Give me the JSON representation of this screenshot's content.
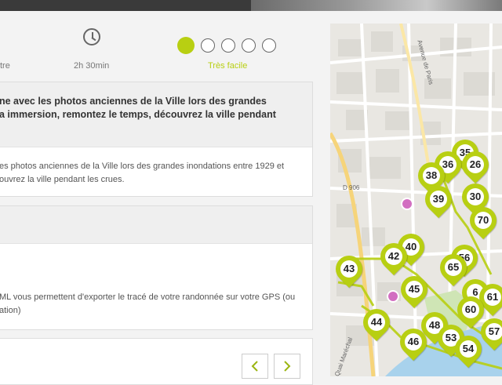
{
  "info": {
    "difficulty_partial": "tre",
    "duration": "2h 30min",
    "level": "Très facile"
  },
  "difficulty_dots": [
    true,
    false,
    false,
    false,
    false
  ],
  "level_color": "#b8cf12",
  "card1": {
    "head_line1": "ne avec les photos anciennes de la Ville lors des grandes",
    "head_line2": "a immersion, remontez le temps, découvrez la ville pendant",
    "body_line1": "es photos anciennes de la Ville lors des grandes inondations entre 1929 et",
    "body_line2": "ouvrez la ville pendant les crues."
  },
  "card2": {
    "body_line1": "ML vous permettent d'exporter le tracé de votre randonnée sur votre GPS (ou",
    "body_line2": "ation)"
  },
  "nav": {
    "prev": "‹",
    "next": "›"
  },
  "map": {
    "street_labels": [
      "Avenue de Paris",
      "D 906",
      "Quai Maréchal"
    ],
    "markers": [
      {
        "num": "35"
      },
      {
        "num": "36"
      },
      {
        "num": "26"
      },
      {
        "num": "38"
      },
      {
        "num": "39"
      },
      {
        "num": "30"
      },
      {
        "num": "70"
      },
      {
        "num": "40"
      },
      {
        "num": "42"
      },
      {
        "num": "56"
      },
      {
        "num": "43"
      },
      {
        "num": "65"
      },
      {
        "num": "45"
      },
      {
        "num": "6"
      },
      {
        "num": "61"
      },
      {
        "num": "60"
      },
      {
        "num": "44"
      },
      {
        "num": "48"
      },
      {
        "num": "46"
      },
      {
        "num": "53"
      },
      {
        "num": "57"
      },
      {
        "num": "54"
      }
    ]
  }
}
